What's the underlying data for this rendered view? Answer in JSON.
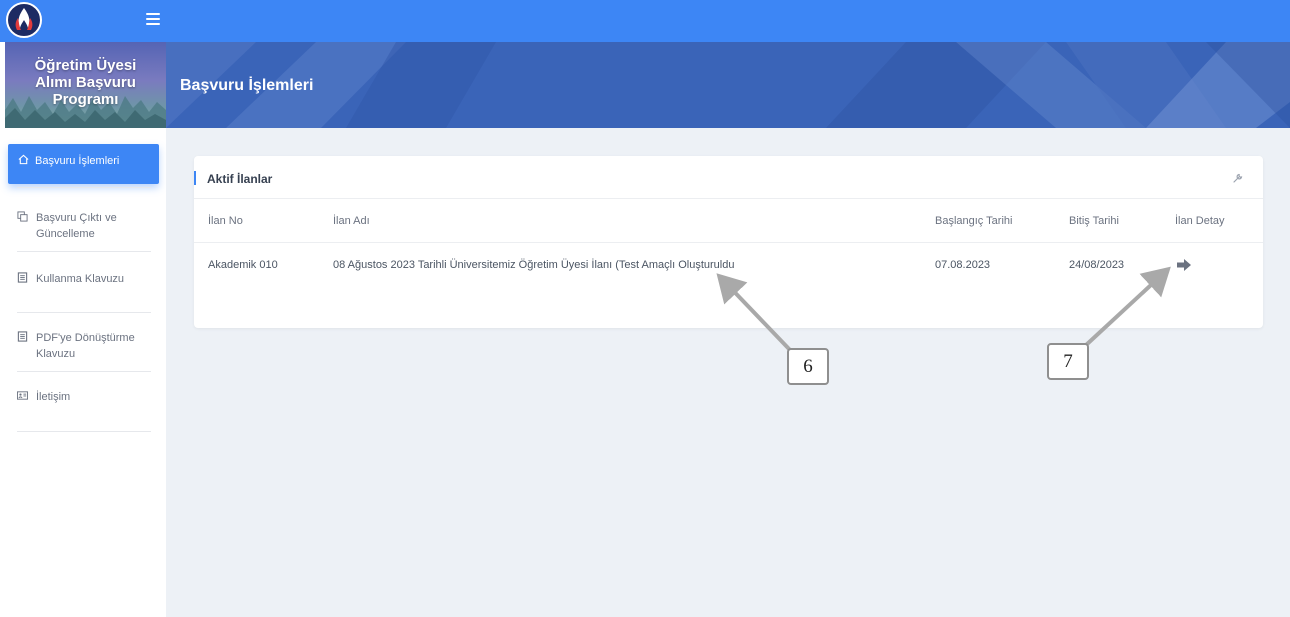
{
  "sidebar": {
    "brand_title": "Öğretim Üyesi\nAlımı Başvuru\nProgramı",
    "active_item": {
      "label": "Başvuru İşlemleri",
      "icon": "home-icon"
    },
    "items": [
      {
        "label": "Başvuru Çıktı ve Güncelleme",
        "icon": "copy-icon"
      },
      {
        "label": "Kullanma Klavuzu",
        "icon": "document-icon"
      },
      {
        "label": "PDF'ye Dönüştürme Klavuzu",
        "icon": "document-icon"
      },
      {
        "label": "İletişim",
        "icon": "contact-card-icon"
      }
    ]
  },
  "header": {
    "title": "Başvuru İşlemleri"
  },
  "card": {
    "title": "Aktif İlanlar",
    "columns": [
      "İlan No",
      "İlan Adı",
      "Başlangıç Tarihi",
      "Bitiş Tarihi",
      "İlan Detay"
    ],
    "rows": [
      {
        "ilan_no": "Akademik 010",
        "ilan_adi": "08 Ağustos 2023 Tarihli Üniversitemiz Öğretim Üyesi İlanı (Test Amaçlı Oluşturuldu",
        "baslangic": "07.08.2023",
        "bitis": "24/08/2023",
        "detail_icon": "arrow-right-icon"
      }
    ]
  },
  "annotations": [
    "6",
    "7"
  ],
  "colors": {
    "topbar": "#3d86f5",
    "header": "#3a64b8",
    "content_bg": "#edf1f6",
    "accent": "#3d86f5"
  }
}
